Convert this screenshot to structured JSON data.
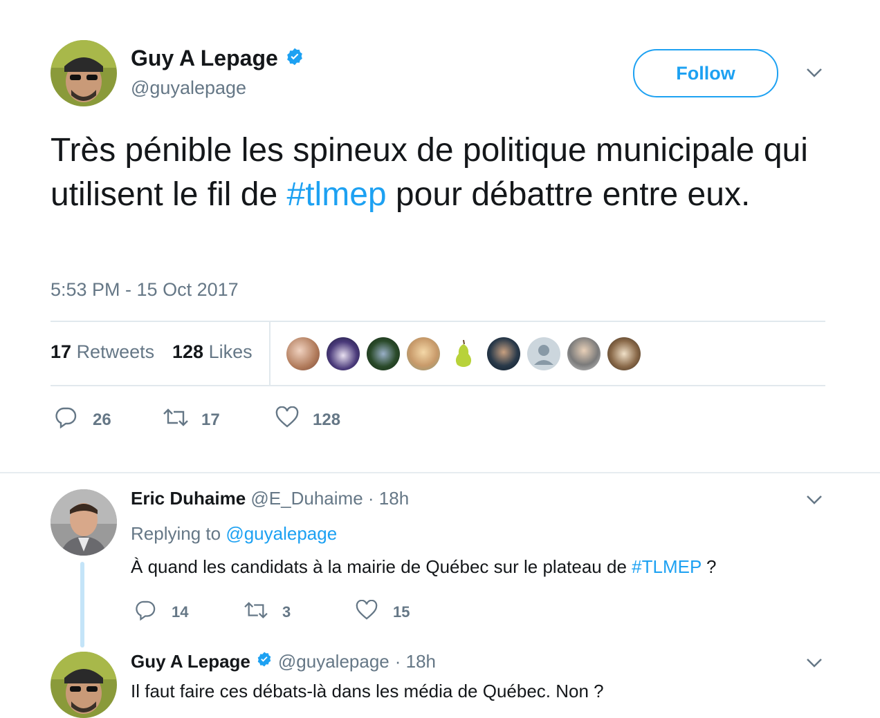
{
  "main_tweet": {
    "author_name": "Guy A Lepage",
    "author_handle": "@guyalepage",
    "follow_label": "Follow",
    "text_before": "Très pénible les spineux de politique municipale qui utilisent le fil de ",
    "hashtag": "#tlmep",
    "text_after": " pour débattre entre eux.",
    "timestamp": "5:53 PM - 15 Oct 2017",
    "retweets_count": "17",
    "retweets_label": "Retweets",
    "likes_count": "128",
    "likes_label": "Likes",
    "reply_count": "26",
    "retweet_count": "17",
    "like_count": "128"
  },
  "replies": [
    {
      "author_name": "Eric Duhaime",
      "author_handle": "@E_Duhaime",
      "time": "· 18h",
      "replying_prefix": "Replying to",
      "replying_to": "@guyalepage",
      "text_before": "À quand les candidats à la mairie de Québec sur le plateau de ",
      "hashtag": "#TLMEP",
      "text_after": " ?",
      "reply_count": "14",
      "retweet_count": "3",
      "like_count": "15"
    },
    {
      "author_name": "Guy A Lepage",
      "author_handle": "@guyalepage",
      "time": "· 18h",
      "text": "Il faut faire ces débats-là dans les média de Québec. Non ?"
    }
  ],
  "colors": {
    "accent": "#1da1f2",
    "muted": "#657786",
    "divider": "#e1e8ed"
  }
}
